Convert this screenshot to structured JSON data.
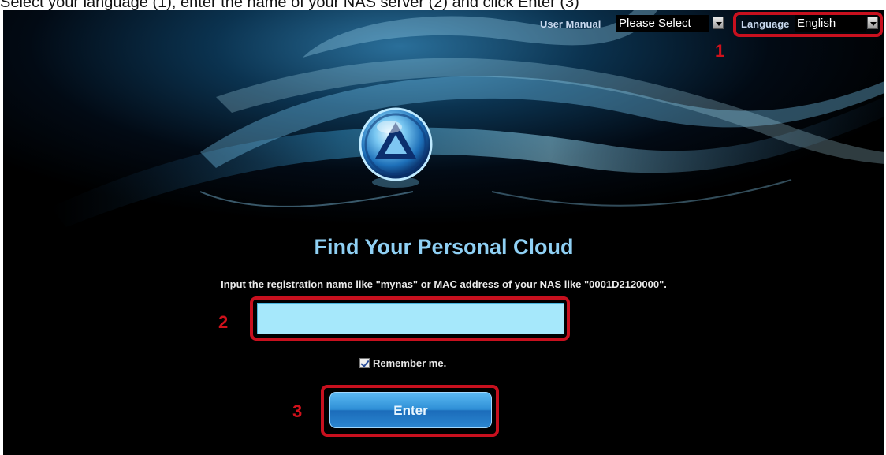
{
  "caption": "Select your language (1), enter the name of your NAS server (2) and click Enter (3)",
  "topbar": {
    "user_manual_label": "User Manual",
    "user_manual_value": "Please Select",
    "language_label": "Language",
    "language_value": "English"
  },
  "callouts": {
    "one": "1",
    "two": "2",
    "three": "3"
  },
  "main": {
    "title": "Find Your Personal Cloud",
    "hint": "Input the registration name like \"mynas\" or MAC address of your NAS like \"0001D2120000\".",
    "name_input_value": "",
    "remember_label": "Remember me.",
    "remember_checked": true,
    "enter_label": "Enter"
  },
  "colors": {
    "callout_red": "#c8101e",
    "title_blue": "#8fd0f4",
    "input_fill": "#a6e8fb",
    "button_blue": "#2f8fd6"
  },
  "icons": {
    "logo": "app-logo-icon",
    "dropdown": "chevron-down-icon",
    "checkbox": "checkbox-checked-icon"
  }
}
